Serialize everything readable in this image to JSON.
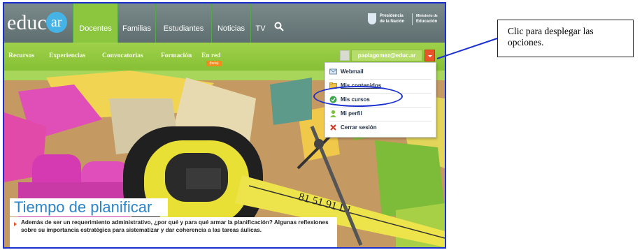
{
  "site": {
    "logo_text": "educ",
    "logo_accent": "ar"
  },
  "top_nav": {
    "tabs": [
      "Docentes",
      "Familias",
      "Estudiantes",
      "Noticias",
      "TV"
    ],
    "active_tab": "Docentes",
    "search_icon": "search-icon"
  },
  "government": {
    "line1": "Presidencia",
    "line2": "de la Nación",
    "line3": "Ministerio de",
    "line4": "Educación"
  },
  "sub_nav": {
    "items": [
      "Recursos",
      "Experiencias",
      "Convocatorias",
      "Formación",
      "En red"
    ],
    "badge": "(beta)"
  },
  "user": {
    "email": "paolagomez@educ.ar",
    "toggle_icon": "chevron-down-icon"
  },
  "dropdown": {
    "items": [
      {
        "label": "Webmail",
        "icon": "mail-icon"
      },
      {
        "label": "Mis contenidos",
        "icon": "folder-icon"
      },
      {
        "label": "Mis cursos",
        "icon": "check-circle-icon"
      },
      {
        "label": "Mi perfil",
        "icon": "user-icon"
      },
      {
        "label": "Cerrar sesión",
        "icon": "close-icon"
      }
    ]
  },
  "hero": {
    "title": "Tiempo de planificar",
    "summary": "Además de ser un requerimiento administrativo, ¿por qué y para qué armar la planificación? Algunas reflexiones sobre su importancia estratégica para sistematizar y dar coherencia a las tareas áulicas."
  },
  "callout": {
    "text": "Clic para desplegar las opciones."
  },
  "colors": {
    "frame": "#1a2fd0",
    "nav_green": "#8cc63e",
    "accent_orange": "#e9542a",
    "title_blue": "#2a84c8"
  }
}
